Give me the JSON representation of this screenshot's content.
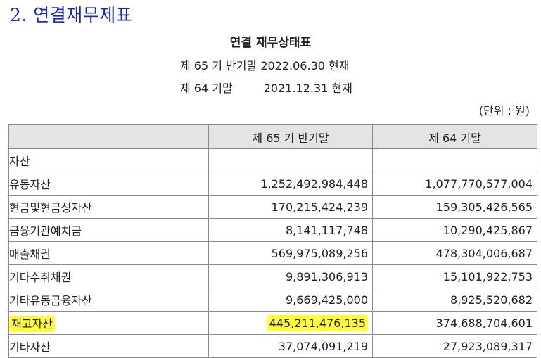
{
  "section_title": "2. 연결재무제표",
  "document": {
    "title": "연결 재무상태표",
    "period_current": {
      "label": "제 65 기 반기말",
      "date": "2022.06.30 현재"
    },
    "period_prior": {
      "label": "제 64 기말",
      "date": "2021.12.31 현재"
    },
    "unit": "(단위 : 원)"
  },
  "table": {
    "headers": [
      "",
      "제 65 기 반기말",
      "제 64 기말"
    ],
    "rows": [
      {
        "name": "자산",
        "current": "",
        "prior": ""
      },
      {
        "name": "유동자산",
        "current": "1,252,492,984,448",
        "prior": "1,077,770,577,004"
      },
      {
        "name": "현금및현금성자산",
        "current": "170,215,424,239",
        "prior": "159,305,426,565"
      },
      {
        "name": "금융기관예치금",
        "current": "8,141,117,748",
        "prior": "10,290,425,867"
      },
      {
        "name": "매출채권",
        "current": "569,975,089,256",
        "prior": "478,304,006,687"
      },
      {
        "name": "기타수취채권",
        "current": "9,891,306,913",
        "prior": "15,101,922,753"
      },
      {
        "name": "기타유동금융자산",
        "current": "9,669,425,000",
        "prior": "8,925,520,682"
      },
      {
        "name": "재고자산",
        "current": "445,211,476,135",
        "prior": "374,688,704,601"
      },
      {
        "name": "기타자산",
        "current": "37,074,091,219",
        "prior": "27,923,089,317"
      }
    ]
  },
  "colors": {
    "section_title": "#1f2aa8",
    "header_bg": "#e4e4e4",
    "highlight": "#ffff3a",
    "border": "#8a8a8a"
  }
}
